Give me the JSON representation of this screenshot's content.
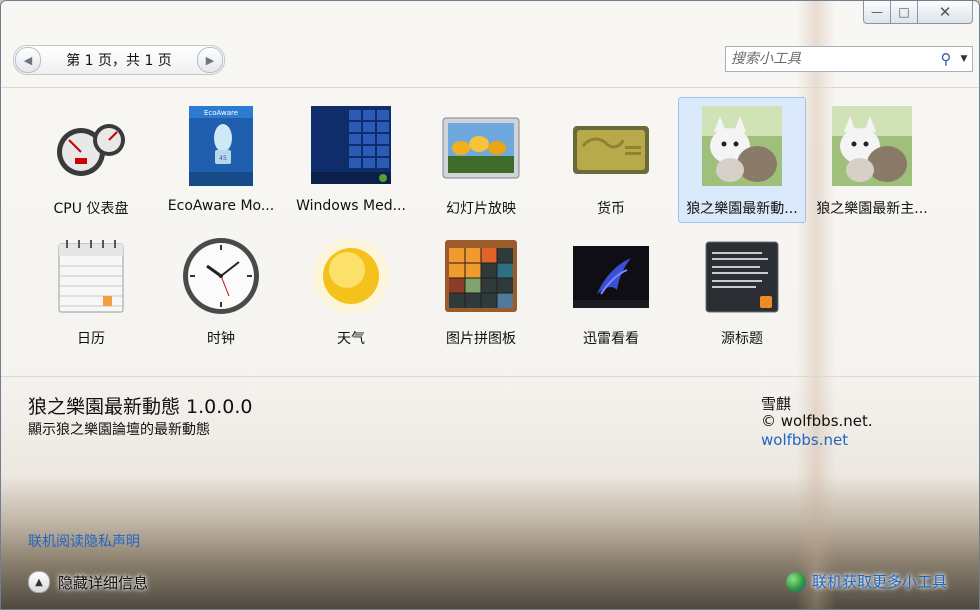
{
  "titlebar": {
    "minimize_icon": "minimize-icon",
    "maximize_icon": "maximize-icon",
    "close_icon": "close-icon"
  },
  "pager": {
    "text": "第 1 页，共 1 页"
  },
  "search": {
    "placeholder": "搜索小工具"
  },
  "gadgets": [
    {
      "label": "CPU 仪表盘",
      "icon": "cpu-meter-icon"
    },
    {
      "label": "EcoAware Mo...",
      "icon": "ecoaware-icon"
    },
    {
      "label": "Windows Med...",
      "icon": "windows-media-center-icon"
    },
    {
      "label": "幻灯片放映",
      "icon": "slideshow-icon"
    },
    {
      "label": "货币",
      "icon": "currency-icon"
    },
    {
      "label": "狼之樂園最新動...",
      "icon": "wolf-dynamics-icon",
      "selected": true
    },
    {
      "label": "狼之樂園最新主...",
      "icon": "wolf-topics-icon"
    },
    {
      "label": "日历",
      "icon": "calendar-icon"
    },
    {
      "label": "时钟",
      "icon": "clock-icon"
    },
    {
      "label": "天气",
      "icon": "weather-icon"
    },
    {
      "label": "图片拼图板",
      "icon": "picture-puzzle-icon"
    },
    {
      "label": "迅雷看看",
      "icon": "xunlei-icon"
    },
    {
      "label": "源标题",
      "icon": "feed-headlines-icon"
    }
  ],
  "details": {
    "title": "狼之樂園最新動態 1.0.0.0",
    "description": "顯示狼之樂園論壇的最新動態",
    "author": "雪麒",
    "copyright": "© wolfbbs.net.",
    "link": "wolfbbs.net"
  },
  "privacy_link": "联机阅读隐私声明",
  "footer": {
    "hide_details": "隐藏详细信息",
    "get_more": "联机获取更多小工具"
  },
  "colors": {
    "link": "#1f66c2",
    "selection": "#d6e8fc"
  }
}
